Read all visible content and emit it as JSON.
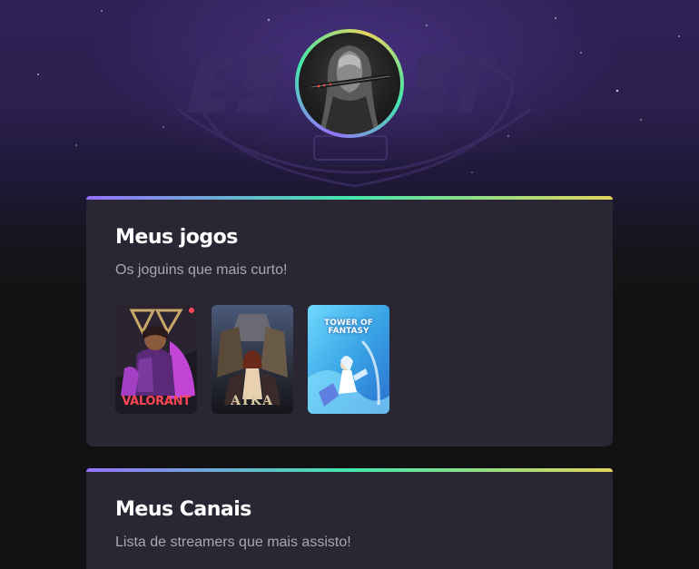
{
  "profile": {
    "avatar_alt": "Foto de perfil",
    "background_logo": "ESPORTS"
  },
  "games_card": {
    "title": "Meus jogos",
    "subtitle": "Os joguins que mais curto!",
    "games": [
      {
        "name": "Valorant",
        "logo": "VALORANT"
      },
      {
        "name": "Aika",
        "logo": "AIKA"
      },
      {
        "name": "Tower of Fantasy",
        "logo": "TOWER OF FANTASY"
      }
    ]
  },
  "channels_card": {
    "title": "Meus Canais",
    "subtitle": "Lista de streamers que mais assisto!"
  },
  "colors": {
    "background": "#121214",
    "card": "#2a2634",
    "gradient": [
      "#9572fc",
      "#43e7ad",
      "#e2d45c"
    ],
    "text": "#ffffff",
    "muted": "#a8a8b3"
  }
}
